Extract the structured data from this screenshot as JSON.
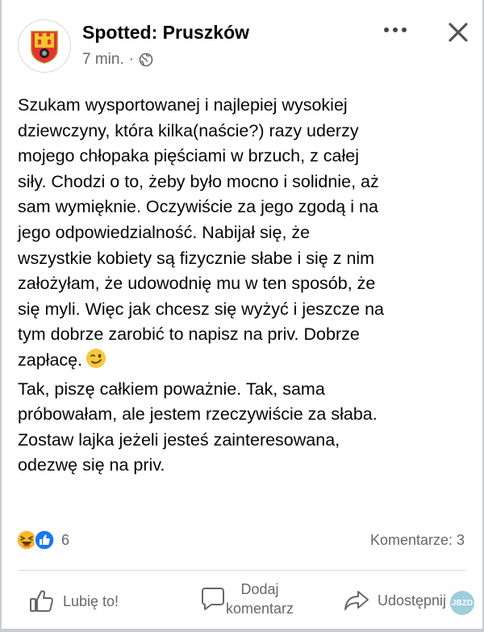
{
  "post": {
    "page_name": "Spotted: Pruszków",
    "time": "7 min.",
    "separator": "·",
    "privacy_icon": "globe-icon",
    "text_main": "Szukam wysportowanej i najlepiej wysokiej\ndziewczyny, która kilka(naście?) razy uderzy\nmojego chłopaka pięściami w brzuch, z całej\nsiły. Chodzi o to, żeby było mocno i solidnie, aż\nsam wymięknie. Oczywiście za jego zgodą i na\njego odpowiedzialność. Nabijał się, że\nwszystkie kobiety są fizycznie słabe i się z nim\nzałożyłam, że udowodnię mu w ten sposób, że\nsię myli. Więc jak chcesz się wyżyć i jeszcze na\ntym dobrze zarobić to napisz na priv. Dobrze\nzapłacę.",
    "text_tail": "Tak, piszę całkiem poważnie. Tak, sama\npróbowałam, ale jestem rzeczywiście za słaba.\nZostaw lajka jeżeli jesteś zainteresowana,\nodezwę się na priv.",
    "emoji": "wink-emoji"
  },
  "reactions": {
    "count": "6",
    "icons": [
      "laughing-reaction-icon",
      "like-reaction-icon"
    ],
    "comments": "Komentarze: 3"
  },
  "actions": {
    "like": "Lubię to!",
    "comment_line1": "Dodaj",
    "comment_line2": "komentarz",
    "share": "Udostępnij"
  },
  "watermark": "JBZD",
  "colors": {
    "text": "#050505",
    "secondary": "#65676b",
    "like_blue": "#1877f2",
    "haha_yellow": "#f7b928"
  }
}
